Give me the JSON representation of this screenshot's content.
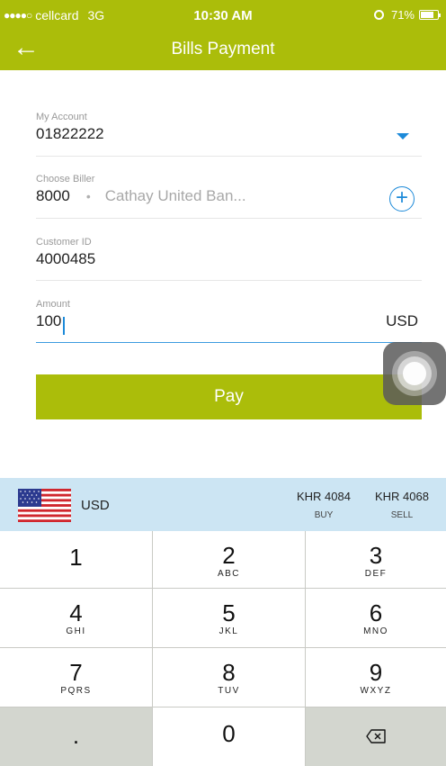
{
  "status_bar": {
    "signal": "●●●●○",
    "carrier": "cellcard",
    "network": "3G",
    "time": "10:30 AM",
    "battery": "71%"
  },
  "nav": {
    "back_icon": "arrow-left-icon",
    "title": "Bills Payment"
  },
  "form": {
    "account": {
      "label": "My Account",
      "value": "01822222"
    },
    "biller": {
      "label": "Choose Biller",
      "code": "8000",
      "separator": "•",
      "name": "Cathay United Ban..."
    },
    "customer": {
      "label": "Customer ID",
      "value": "4000485"
    },
    "amount": {
      "label": "Amount",
      "value": "100",
      "currency": "USD"
    },
    "pay_label": "Pay"
  },
  "rates": {
    "currency": "USD",
    "buy": {
      "value": "KHR 4084",
      "label": "BUY"
    },
    "sell": {
      "value": "KHR 4068",
      "label": "SELL"
    }
  },
  "keypad": {
    "keys": [
      {
        "num": "1",
        "sub": ""
      },
      {
        "num": "2",
        "sub": "ABC"
      },
      {
        "num": "3",
        "sub": "DEF"
      },
      {
        "num": "4",
        "sub": "GHI"
      },
      {
        "num": "5",
        "sub": "JKL"
      },
      {
        "num": "6",
        "sub": "MNO"
      },
      {
        "num": "7",
        "sub": "PQRS"
      },
      {
        "num": "8",
        "sub": "TUV"
      },
      {
        "num": "9",
        "sub": "WXYZ"
      },
      {
        "num": ".",
        "sub": ""
      },
      {
        "num": "0",
        "sub": ""
      },
      {
        "num": "",
        "sub": ""
      }
    ]
  },
  "colors": {
    "brand": "#abbd0a",
    "accent": "#1d8ad9",
    "rates_bar": "#cce5f3"
  }
}
